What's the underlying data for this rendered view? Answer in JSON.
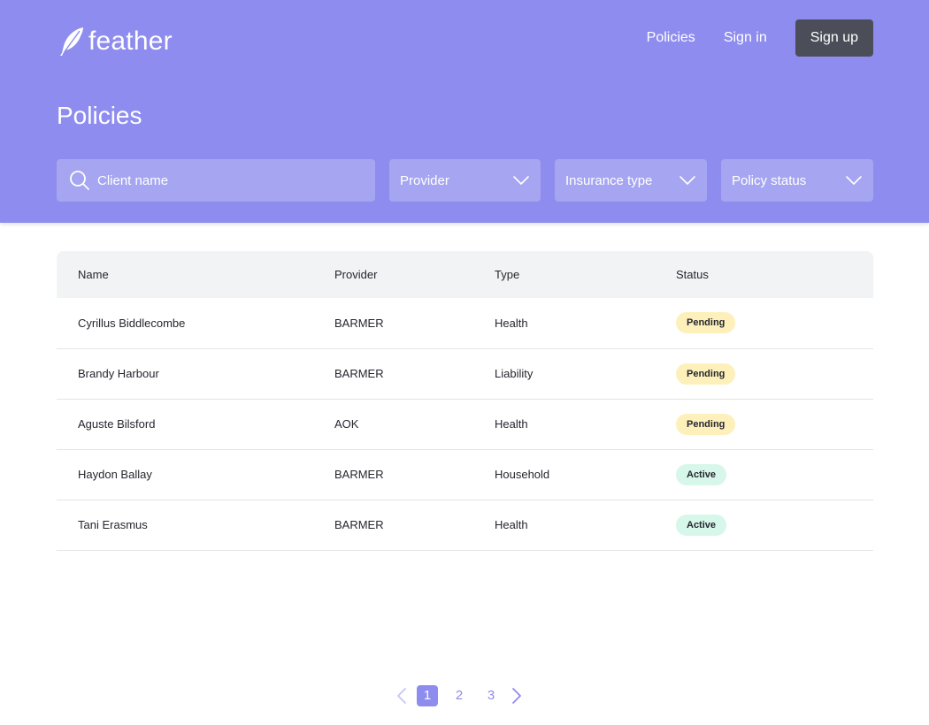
{
  "brand": {
    "name": "feather"
  },
  "nav": {
    "policies": "Policies",
    "sign_in": "Sign in",
    "sign_up": "Sign up"
  },
  "page": {
    "title": "Policies"
  },
  "filters": {
    "search_placeholder": "Client name",
    "provider": "Provider",
    "insurance_type": "Insurance type",
    "policy_status": "Policy status"
  },
  "table": {
    "headers": {
      "name": "Name",
      "provider": "Provider",
      "type": "Type",
      "status": "Status"
    },
    "rows": [
      {
        "name": "Cyrillus Biddlecombe",
        "provider": "BARMER",
        "type": "Health",
        "status": "Pending"
      },
      {
        "name": "Brandy Harbour",
        "provider": "BARMER",
        "type": "Liability",
        "status": "Pending"
      },
      {
        "name": "Aguste Bilsford",
        "provider": "AOK",
        "type": "Health",
        "status": "Pending"
      },
      {
        "name": "Haydon Ballay",
        "provider": "BARMER",
        "type": "Household",
        "status": "Active"
      },
      {
        "name": "Tani Erasmus",
        "provider": "BARMER",
        "type": "Health",
        "status": "Active"
      }
    ]
  },
  "pagination": {
    "pages": [
      "1",
      "2",
      "3"
    ],
    "current": "1"
  },
  "colors": {
    "accent": "#8e8cee",
    "dark_button": "#4b4e59",
    "pending_badge": "#fdf0bb",
    "active_badge": "#d6f7ea"
  },
  "icons": [
    "feather-icon",
    "search-icon",
    "chevron-down-icon",
    "chevron-left-icon",
    "chevron-right-icon"
  ]
}
